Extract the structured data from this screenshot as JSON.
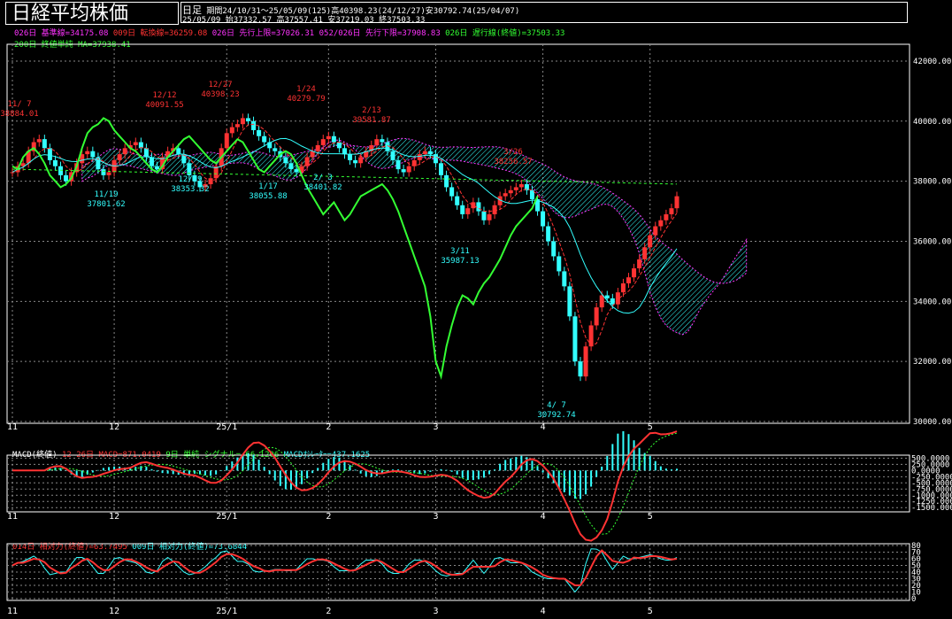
{
  "header": {
    "title": "日経平均株価",
    "period_label": "日足",
    "period_info": "期間24/10/31～25/05/09(125)高40398.23(24/12/27)安30792.74(25/04/07)",
    "date": "25/05/09",
    "ohlc": "始37332.57 高37557.41 安37219.03 終37503.33"
  },
  "legends": {
    "main": [
      {
        "text": "026日 基準線=34175.08",
        "color": "#ff33ff"
      },
      {
        "text": "009日 転換線=36259.08",
        "color": "#ff3333"
      },
      {
        "text": "026日 先行上限=37026.31",
        "color": "#ff33ff"
      },
      {
        "text": "052/026日 先行下限=37908.83",
        "color": "#ff33ff"
      },
      {
        "text": "026日 遅行線(終値)=37503.33",
        "color": "#33ff33"
      }
    ],
    "ma": {
      "text": "200日 終値単純 MA=37938.41",
      "color": "#33ff33"
    },
    "macd": [
      {
        "text": "MACD(終値)",
        "color": "#ffffff"
      },
      {
        "text": "12-26日 MACD=871.0419",
        "color": "#ff3333"
      },
      {
        "text": "9日 単純 シグナル=-66.1206",
        "color": "#33ff33"
      },
      {
        "text": "MACDｵｼﾚｰﾀｰ=437.1625",
        "color": "#33ffff"
      }
    ],
    "rsi": [
      {
        "text": "014日 相対力(終値)=63.7495",
        "color": "#ff3333"
      },
      {
        "text": "009日 相対力(終値)=73.6844",
        "color": "#33ffff"
      }
    ]
  },
  "chart_data": [
    {
      "type": "candlestick",
      "title": "日経平均株価",
      "x_labels": [
        "11",
        "12",
        "25/1",
        "2",
        "3",
        "4",
        "5"
      ],
      "ylim": [
        30000,
        42500
      ],
      "y_ticks": [
        "42000.00",
        "40000.00",
        "38000.00",
        "36000.00",
        "34000.00",
        "32000.00",
        "30000.00"
      ],
      "close": [
        38300,
        38500,
        38600,
        39000,
        39300,
        39400,
        39100,
        38700,
        38500,
        38200,
        38000,
        38300,
        38600,
        38900,
        39000,
        38800,
        38400,
        38200,
        38300,
        38700,
        38900,
        39100,
        39200,
        39300,
        39100,
        38800,
        38500,
        38400,
        38800,
        39000,
        39100,
        38900,
        38600,
        38200,
        38000,
        37800,
        37900,
        38100,
        38500,
        39100,
        39600,
        39800,
        39900,
        40100,
        40000,
        39700,
        39500,
        39300,
        39100,
        39000,
        38800,
        38600,
        38400,
        38300,
        38500,
        38800,
        39000,
        39200,
        39400,
        39500,
        39300,
        39100,
        38900,
        38700,
        38600,
        38800,
        39000,
        39200,
        39400,
        39300,
        39000,
        38700,
        38400,
        38300,
        38500,
        38700,
        38900,
        39000,
        38900,
        38600,
        38200,
        37800,
        37500,
        37200,
        36900,
        37100,
        37300,
        37000,
        36700,
        36900,
        37200,
        37500,
        37600,
        37700,
        37800,
        37900,
        37700,
        37400,
        37000,
        36500,
        36000,
        35500,
        35000,
        34500,
        33500,
        32000,
        31500,
        32500,
        33200,
        33800,
        34200,
        34100,
        33900,
        34300,
        34600,
        34800,
        35100,
        35400,
        35800,
        36200,
        36500,
        36700,
        36900,
        37100,
        37500
      ],
      "labels": [
        {
          "text": "11/ 7",
          "value": "38884.01",
          "color": "#ff3333"
        },
        {
          "text": "12/12",
          "value": "40091.55",
          "color": "#ff3333"
        },
        {
          "text": "12/27",
          "value": "40398.23",
          "color": "#ff3333"
        },
        {
          "text": "1/24",
          "value": "40279.79",
          "color": "#ff3333"
        },
        {
          "text": "2/13",
          "value": "39581.87",
          "color": "#ff3333"
        },
        {
          "text": "3/26",
          "value": "38256.57",
          "color": "#ff3333"
        },
        {
          "text": "11/19",
          "value": "37801.62",
          "color": "#33ffff"
        },
        {
          "text": "12/19",
          "value": "38353.32",
          "color": "#33ffff"
        },
        {
          "text": "1/17",
          "value": "38055.88",
          "color": "#33ffff"
        },
        {
          "text": "2/ 3",
          "value": "38401.82",
          "color": "#33ffff"
        },
        {
          "text": "3/11",
          "value": "35987.13",
          "color": "#33ffff"
        },
        {
          "text": "4/ 7",
          "value": "30792.74",
          "color": "#33ffff"
        }
      ]
    },
    {
      "type": "line",
      "title": "MACD(終値)",
      "y_ticks": [
        "500.0000",
        "250.0000",
        "0.0000",
        "-250.0000",
        "-500.0000",
        "-750.0000",
        "-1000.0000",
        "-1250.0000",
        "-1500.0000"
      ],
      "ylim": [
        -1600,
        550
      ]
    },
    {
      "type": "line",
      "title": "相対力(終値)",
      "y_ticks": [
        "80",
        "70",
        "60",
        "50",
        "40",
        "30",
        "20",
        "10",
        "0"
      ],
      "ylim": [
        0,
        80
      ]
    }
  ]
}
